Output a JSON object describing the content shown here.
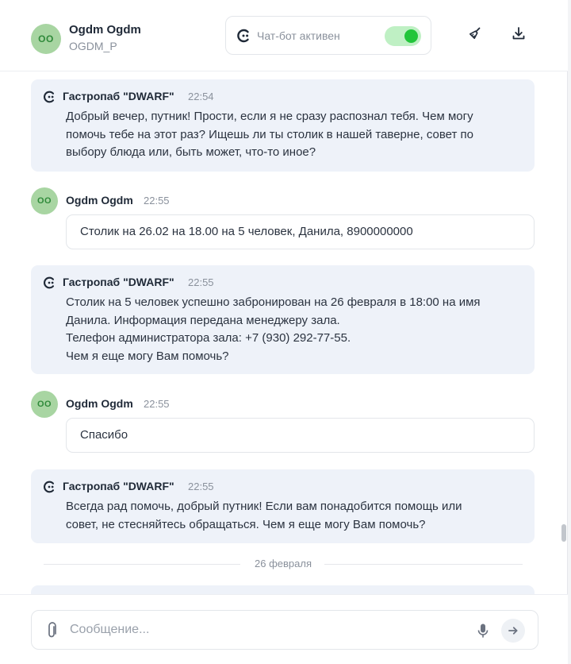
{
  "header": {
    "avatar_initials": "OO",
    "user_name": "Ogdm Ogdm",
    "user_login": "OGDM_P",
    "bot_status": "Чат-бот активен",
    "toggle_on": true,
    "icons": [
      "bot-logo-icon",
      "broom-icon",
      "download-icon"
    ]
  },
  "messages": [
    {
      "type": "bot",
      "sender": "Гастропаб \"DWARF\"",
      "time": "22:54",
      "lines": [
        "Добрый вечер, путник! Прости, если я не сразу распознал тебя. Чем могу",
        "помочь тебе на этот раз? Ищешь ли ты столик в нашей таверне, совет по",
        "выбору блюда или, быть может, что-то иное?"
      ]
    },
    {
      "type": "user",
      "avatar_initials": "OO",
      "sender": "Ogdm Ogdm",
      "time": "22:55",
      "text": "Столик на 26.02 на 18.00 на 5 человек, Данила, 8900000000"
    },
    {
      "type": "bot",
      "sender": "Гастропаб \"DWARF\"",
      "time": "22:55",
      "lines": [
        "Столик на 5 человек успешно забронирован на 26 февраля в 18:00 на имя",
        "Данила. Информация передана менеджеру зала.",
        "Телефон администратора зала: +7 (930) 292-77-55.",
        "Чем я еще могу Вам помочь?"
      ]
    },
    {
      "type": "user",
      "avatar_initials": "OO",
      "sender": "Ogdm Ogdm",
      "time": "22:55",
      "text": "Спасибо"
    },
    {
      "type": "bot",
      "sender": "Гастропаб \"DWARF\"",
      "time": "22:55",
      "lines": [
        "Всегда рад помочь, добрый путник! Если вам понадобится помощь или",
        "совет, не стесняйтесь обращаться. Чем я еще могу Вам помочь?"
      ]
    }
  ],
  "date_separator": "26 февраля",
  "composer": {
    "placeholder": "Сообщение...",
    "value": ""
  },
  "colors": {
    "bot_bubble": "#eef2f9",
    "avatar_bg": "#a8d5a2",
    "avatar_text": "#2f8a3a",
    "toggle_track": "#bff0c4",
    "toggle_knob": "#22c53a"
  }
}
